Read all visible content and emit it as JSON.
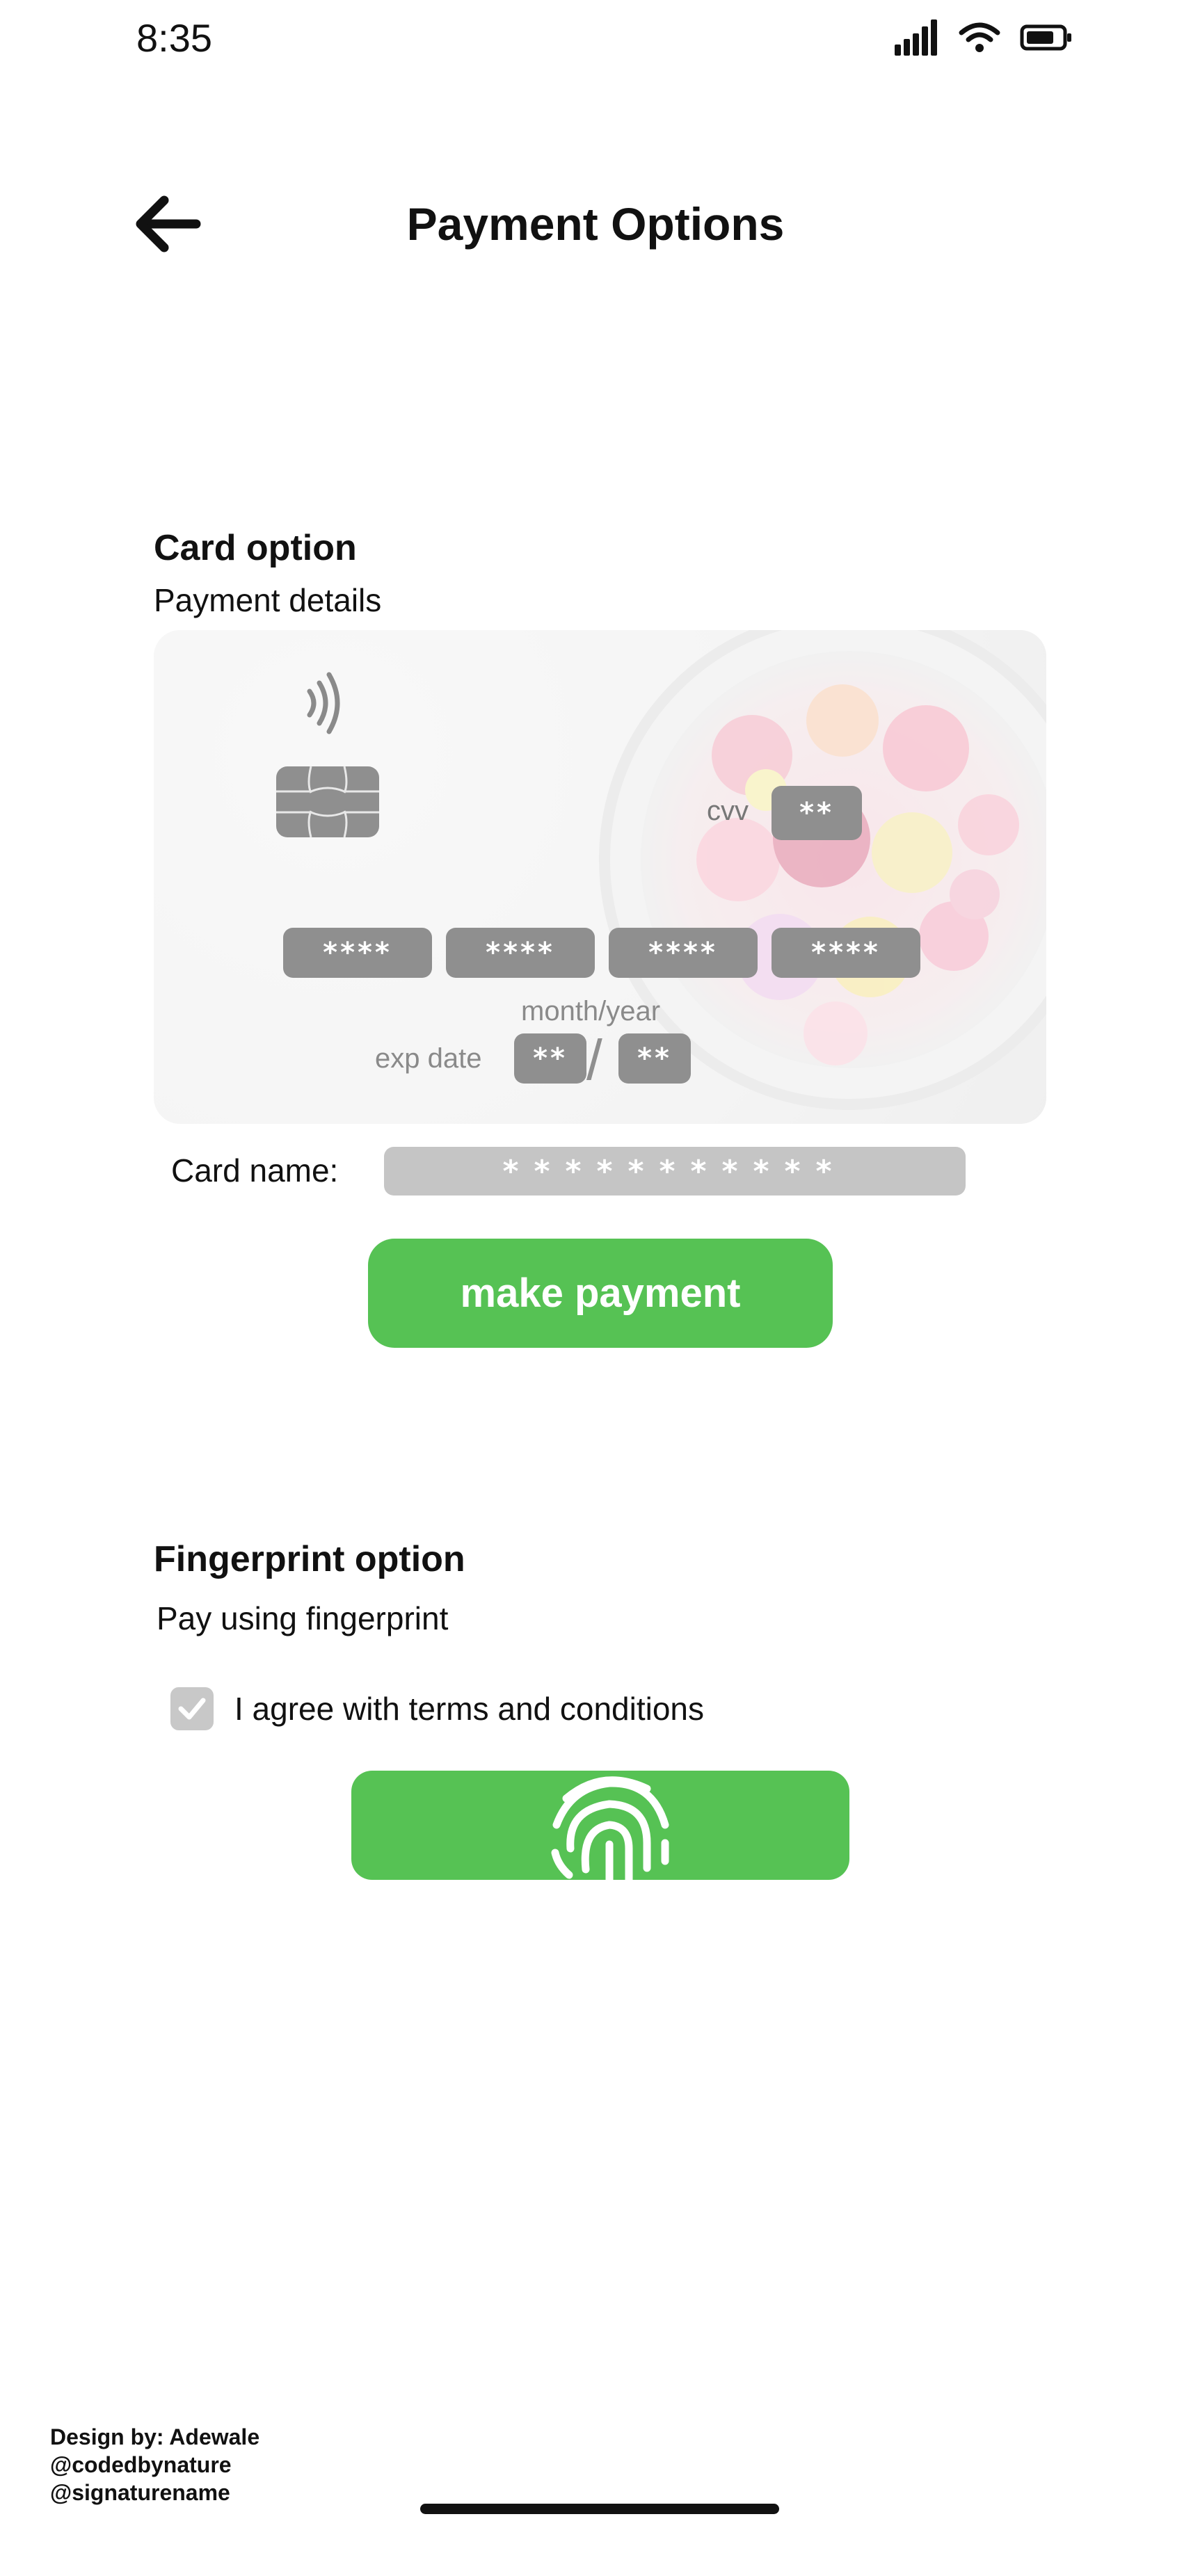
{
  "status_bar": {
    "time": "8:35"
  },
  "header": {
    "title": "Payment Options"
  },
  "card_option": {
    "title": "Card option",
    "subtitle": "Payment details",
    "cvv_label": "cvv",
    "cvv_value": "**",
    "card_number_groups": [
      "****",
      "****",
      "****",
      "****"
    ],
    "month_year_label": "month/year",
    "exp_label": "exp date",
    "exp_month": "**",
    "exp_slash": "/",
    "exp_year": "**",
    "card_name_label": "Card name:",
    "card_name_value": "***********",
    "make_payment_label": "make payment"
  },
  "fingerprint_option": {
    "title": "Fingerprint option",
    "subtitle": "Pay using fingerprint",
    "agree_label": "I agree with terms and conditions",
    "agree_checked": true
  },
  "footer": {
    "credits": [
      "Design by: Adewale",
      "@codedbynature",
      "@signaturename"
    ]
  },
  "colors": {
    "accent_green": "#56c254",
    "pill_gray": "#8f8f8f",
    "field_gray": "#c5c5c5"
  },
  "icons": [
    "cellular-signal-icon",
    "wifi-icon",
    "battery-icon",
    "back-arrow-icon",
    "contactless-icon",
    "chip-icon",
    "checkmark-icon",
    "fingerprint-icon"
  ]
}
